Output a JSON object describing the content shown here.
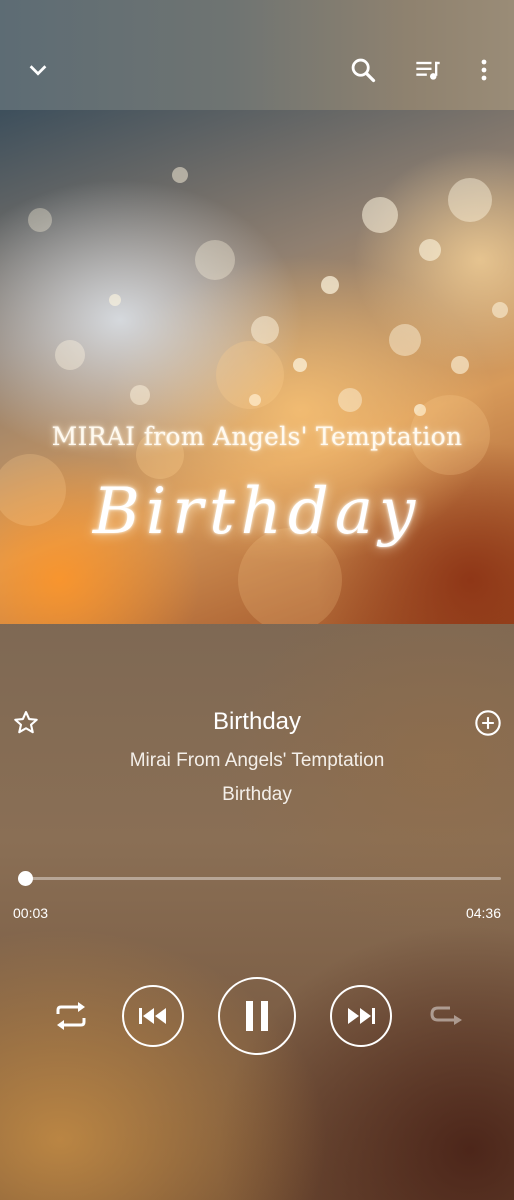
{
  "header": {
    "collapse_icon": "chevron-down-icon",
    "search_icon": "search-icon",
    "queue_icon": "playlist-icon",
    "more_icon": "more-vertical-icon"
  },
  "album_art": {
    "artist_text": "MIRAI from Angels' Temptation",
    "title_text": "Birthday"
  },
  "track": {
    "title": "Birthday",
    "artist": "Mirai From Angels' Temptation",
    "album": "Birthday",
    "favorite_icon": "star-outline-icon",
    "add_icon": "add-circle-icon"
  },
  "playback": {
    "elapsed": "00:03",
    "duration": "04:36",
    "progress_fraction": 0.011,
    "state": "playing"
  },
  "controls": {
    "shuffle_icon": "repeat-icon",
    "previous_icon": "skip-previous-icon",
    "play_pause_icon": "pause-icon",
    "next_icon": "skip-next-icon",
    "repeat_icon": "repeat-disabled-icon"
  }
}
